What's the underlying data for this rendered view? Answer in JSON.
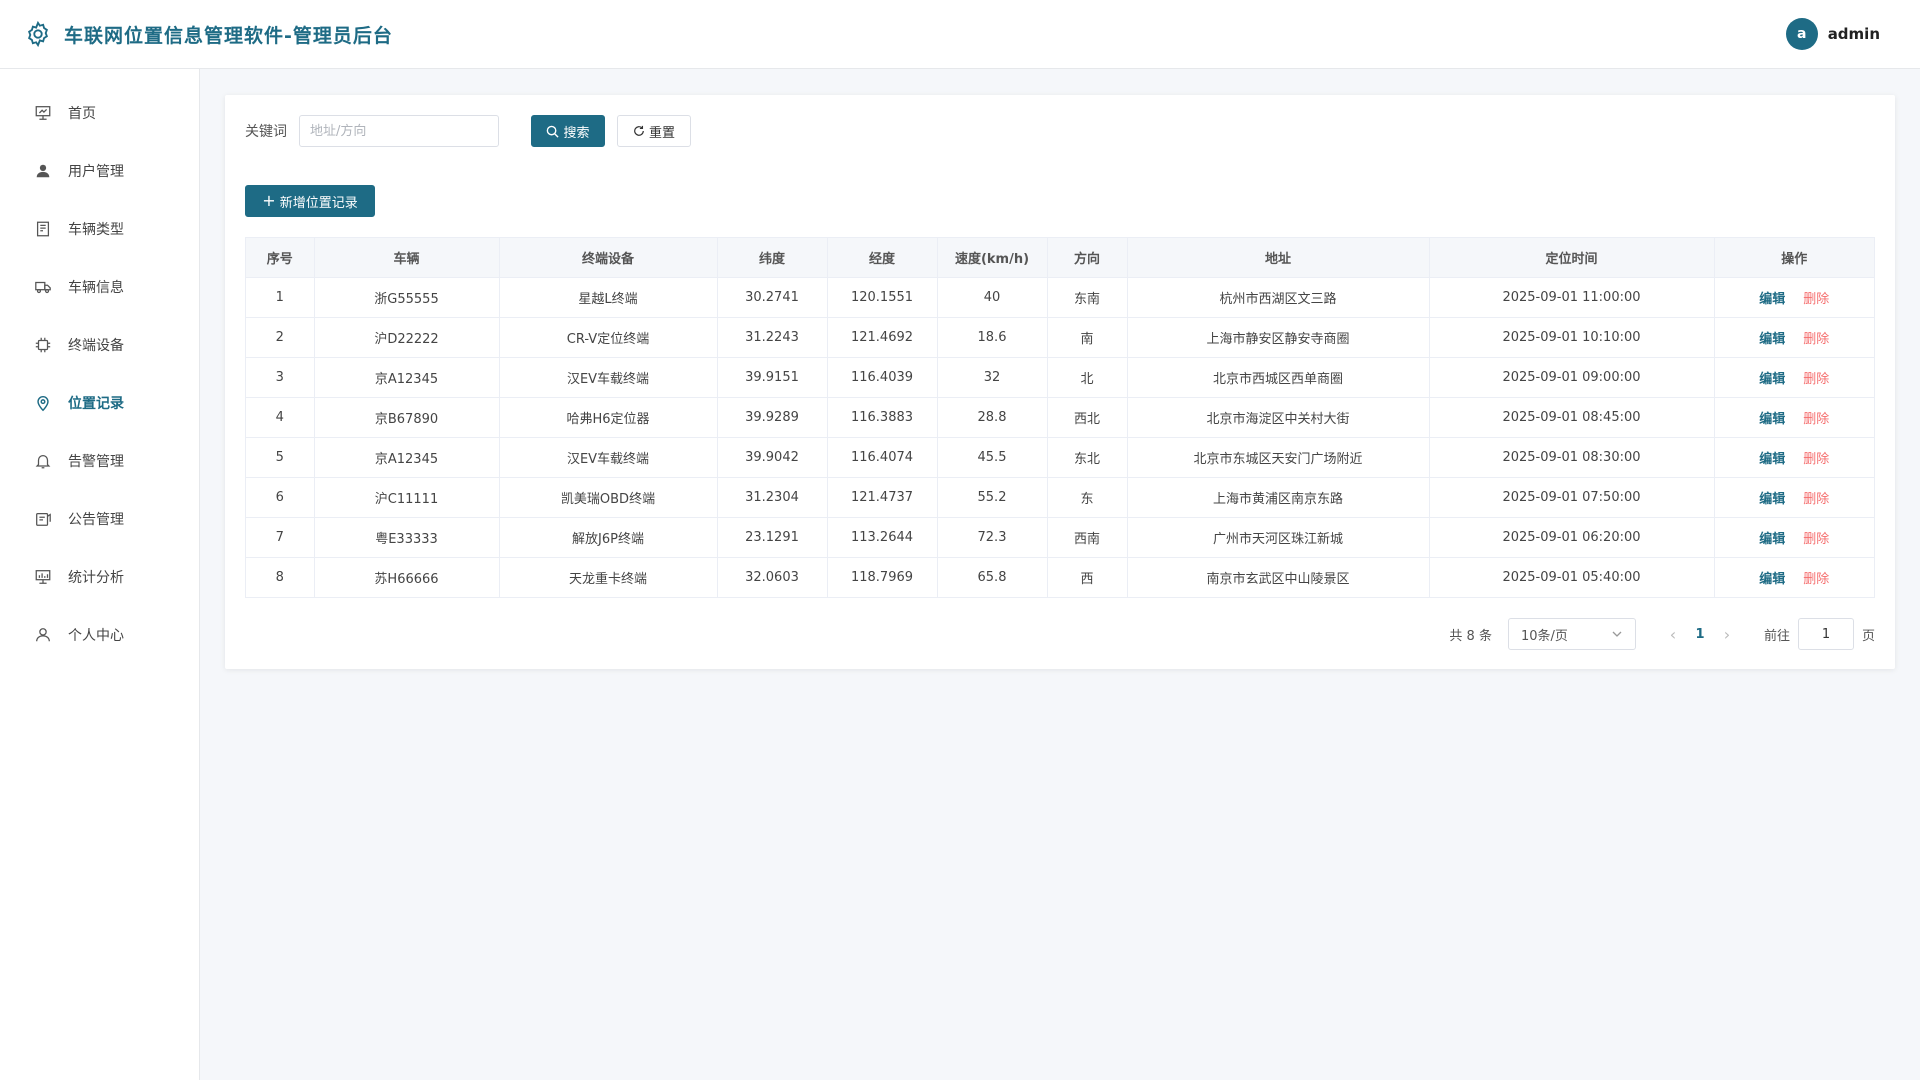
{
  "header": {
    "title": "车联网位置信息管理软件-管理员后台",
    "avatar_letter": "a",
    "username": "admin"
  },
  "colors": {
    "accent": "#1e6b85",
    "danger": "#f56c6c"
  },
  "sidebar": {
    "items": [
      {
        "label": "首页",
        "icon": "dashboard-icon"
      },
      {
        "label": "用户管理",
        "icon": "user-icon"
      },
      {
        "label": "车辆类型",
        "icon": "tag-icon"
      },
      {
        "label": "车辆信息",
        "icon": "truck-icon"
      },
      {
        "label": "终端设备",
        "icon": "chip-icon"
      },
      {
        "label": "位置记录",
        "icon": "location-icon",
        "active": true
      },
      {
        "label": "告警管理",
        "icon": "bell-icon"
      },
      {
        "label": "公告管理",
        "icon": "notice-icon"
      },
      {
        "label": "统计分析",
        "icon": "chart-icon"
      },
      {
        "label": "个人中心",
        "icon": "profile-icon"
      }
    ]
  },
  "search": {
    "label": "关键词",
    "placeholder": "地址/方向",
    "value": "",
    "search_label": "搜索",
    "reset_label": "重置"
  },
  "add_label": "新增位置记录",
  "table": {
    "columns": [
      "序号",
      "车辆",
      "终端设备",
      "纬度",
      "经度",
      "速度(km/h)",
      "方向",
      "地址",
      "定位时间",
      "操作"
    ],
    "edit_label": "编辑",
    "delete_label": "删除",
    "rows": [
      [
        "1",
        "浙G55555",
        "星越L终端",
        "30.2741",
        "120.1551",
        "40",
        "东南",
        "杭州市西湖区文三路",
        "2025-09-01 11:00:00"
      ],
      [
        "2",
        "沪D22222",
        "CR-V定位终端",
        "31.2243",
        "121.4692",
        "18.6",
        "南",
        "上海市静安区静安寺商圈",
        "2025-09-01 10:10:00"
      ],
      [
        "3",
        "京A12345",
        "汉EV车载终端",
        "39.9151",
        "116.4039",
        "32",
        "北",
        "北京市西城区西单商圈",
        "2025-09-01 09:00:00"
      ],
      [
        "4",
        "京B67890",
        "哈弗H6定位器",
        "39.9289",
        "116.3883",
        "28.8",
        "西北",
        "北京市海淀区中关村大街",
        "2025-09-01 08:45:00"
      ],
      [
        "5",
        "京A12345",
        "汉EV车载终端",
        "39.9042",
        "116.4074",
        "45.5",
        "东北",
        "北京市东城区天安门广场附近",
        "2025-09-01 08:30:00"
      ],
      [
        "6",
        "沪C11111",
        "凯美瑞OBD终端",
        "31.2304",
        "121.4737",
        "55.2",
        "东",
        "上海市黄浦区南京东路",
        "2025-09-01 07:50:00"
      ],
      [
        "7",
        "粤E33333",
        "解放J6P终端",
        "23.1291",
        "113.2644",
        "72.3",
        "西南",
        "广州市天河区珠江新城",
        "2025-09-01 06:20:00"
      ],
      [
        "8",
        "苏H66666",
        "天龙重卡终端",
        "32.0603",
        "118.7969",
        "65.8",
        "西",
        "南京市玄武区中山陵景区",
        "2025-09-01 05:40:00"
      ]
    ]
  },
  "pagination": {
    "total_text": "共 8 条",
    "page_size": "10条/页",
    "current_page": "1",
    "goto_label": "前往",
    "goto_value": "1",
    "page_suffix": "页"
  }
}
